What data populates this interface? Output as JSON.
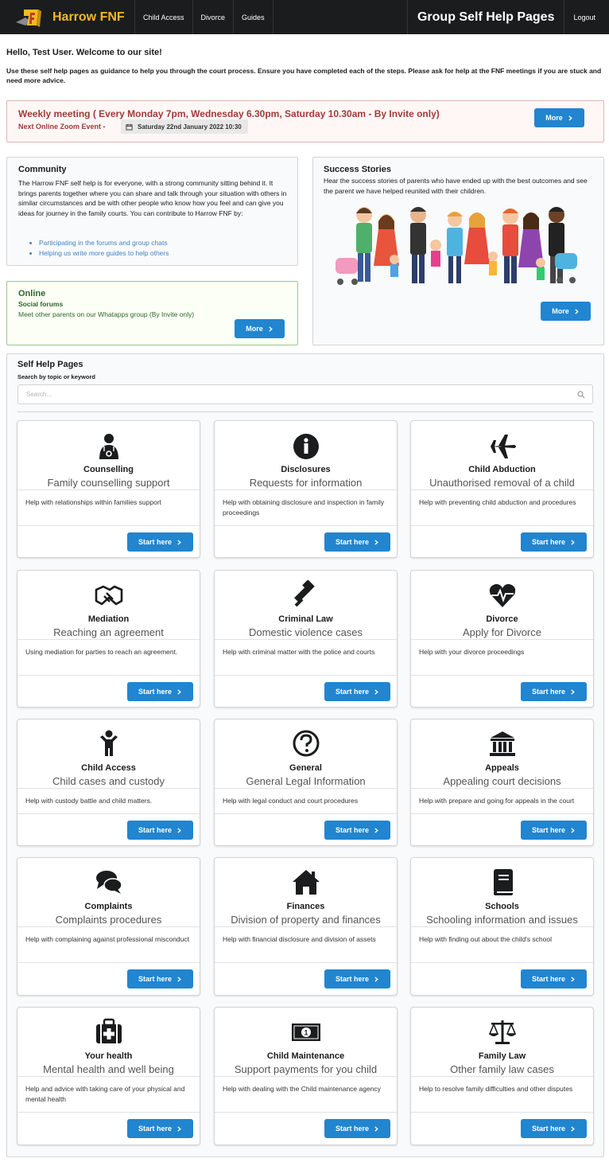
{
  "header": {
    "logo_text": "Harrow FNF",
    "nav": [
      "Child Access",
      "Divorce",
      "Guides"
    ],
    "page_title": "Group Self Help Pages",
    "logout": "Logout"
  },
  "greeting": "Hello, Test User.  Welcome to our site!",
  "intro": "Use these self help pages as guidance to help you through the court process. Ensure you have completed each of the steps. Please ask for help at the FNF meetings if you are stuck and need more advice.",
  "meeting": {
    "title": "Weekly meeting ( Every Monday 7pm, Wednesday 6.30pm, Saturday 10.30am - By Invite only)",
    "next_label": "Next Online Zoom Event -",
    "date": "Saturday 22nd January 2022 10:30",
    "button": "More"
  },
  "community": {
    "title": "Community",
    "text": "The Harrow FNF self help is for everyone, with a strong community sitting behind it. It brings parents together where you can share and talk through your situation with others in similar circumstances and be with other people who know how you feel and can give you ideas for journey in the family courts. You can contribute to Harrow FNF by:",
    "links": [
      "Participating in the forums and group chats",
      "Helping us write more guides to help others"
    ]
  },
  "online": {
    "title": "Online",
    "subtitle": "Social forums",
    "text": "Meet other parents on our Whatapps group (By Invite only)",
    "button": "More"
  },
  "success": {
    "title": "Success Stories",
    "text": "Hear the success stories of parents who have ended up with the best outcomes and see the parent we have helped reunited with their children.",
    "button": "More"
  },
  "selfhelp": {
    "title": "Self Help Pages",
    "search_label": "Search by topic or keyword",
    "search_placeholder": "Search..."
  },
  "colors": {
    "primary": "#2185d0",
    "header_bg": "#1b1c1d",
    "logo": "#f2b928",
    "alert": "#9f3a38",
    "online": "#2c662d"
  },
  "cards": [
    {
      "icon": "doctor-icon",
      "title": "Counselling",
      "subtitle": "Family counselling support",
      "desc": "Help with relationships within families support",
      "button": "Start here"
    },
    {
      "icon": "info-icon",
      "title": "Disclosures",
      "subtitle": "Requests for information",
      "desc": "Help with obtaining disclosure and inspection in family proceedings",
      "button": "Start here"
    },
    {
      "icon": "plane-icon",
      "title": "Child Abduction",
      "subtitle": "Unauthorised removal of a child",
      "desc": "Help with preventing child abduction and procedures",
      "button": "Start here"
    },
    {
      "icon": "handshake-icon",
      "title": "Mediation",
      "subtitle": "Reaching an agreement",
      "desc": "Using mediation for parties to reach an agreement.",
      "button": "Start here"
    },
    {
      "icon": "gavel-icon",
      "title": "Criminal Law",
      "subtitle": "Domestic violence cases",
      "desc": "Help with criminal matter with the police and courts",
      "button": "Start here"
    },
    {
      "icon": "heartbeat-icon",
      "title": "Divorce",
      "subtitle": "Apply for Divorce",
      "desc": "Help with your divorce proceedings",
      "button": "Start here"
    },
    {
      "icon": "child-icon",
      "title": "Child Access",
      "subtitle": "Child cases and custody",
      "desc": "Help with custody battle and child matters.",
      "button": "Start here"
    },
    {
      "icon": "question-icon",
      "title": "General",
      "subtitle": "General Legal Information",
      "desc": "Help with legal conduct and court procedures",
      "button": "Start here"
    },
    {
      "icon": "courthouse-icon",
      "title": "Appeals",
      "subtitle": "Appealing court decisions",
      "desc": "Help with prepare and going for appeals in the court",
      "button": "Start here"
    },
    {
      "icon": "comments-icon",
      "title": "Complaints",
      "subtitle": "Complaints procedures",
      "desc": "Help with complaining against professional misconduct",
      "button": "Start here"
    },
    {
      "icon": "home-icon",
      "title": "Finances",
      "subtitle": "Division of property and finances",
      "desc": "Help with financial disclosure and division of assets",
      "button": "Start here"
    },
    {
      "icon": "book-icon",
      "title": "Schools",
      "subtitle": "Schooling information and issues",
      "desc": "Help with finding out about the child's school",
      "button": "Start here"
    },
    {
      "icon": "medkit-icon",
      "title": "Your health",
      "subtitle": "Mental health and well being",
      "desc": "Help and advice with taking care of your physical and mental health",
      "button": "Start here"
    },
    {
      "icon": "money-bill-icon",
      "title": "Child Maintenance",
      "subtitle": "Support payments for you child",
      "desc": "Help with dealing with the Child maintenance agency",
      "button": "Start here"
    },
    {
      "icon": "scale-icon",
      "title": "Family Law",
      "subtitle": "Other family law cases",
      "desc": "Help to resolve family difficulties and other disputes",
      "button": "Start here"
    }
  ]
}
